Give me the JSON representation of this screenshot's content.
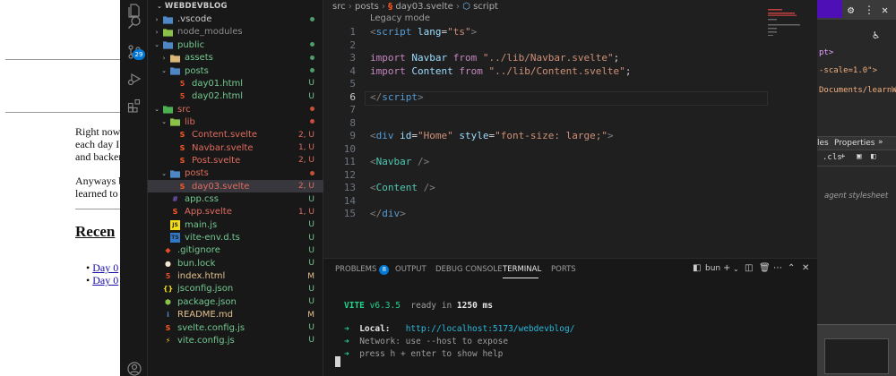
{
  "background_page": {
    "paragraph1": [
      "Right now,",
      "each day I",
      "and backen"
    ],
    "paragraph2": [
      "Anyways b",
      "learned to"
    ],
    "recent_heading": "Recen",
    "recent_items": [
      "Day 0",
      "Day 0"
    ]
  },
  "background_devtools": {
    "code_lines": [
      "pt>",
      "-scale=1.0\">",
      "Documents/learnWe"
    ],
    "tabs": [
      "les",
      "Properties",
      "»"
    ],
    "styles_filter": ".cls",
    "user_agent_text": "agent stylesheet"
  },
  "activity_bar": {
    "scm_badge": "29"
  },
  "explorer": {
    "root": "WEBDEVBLOG",
    "items": [
      {
        "name": ".vscode",
        "type": "folder",
        "open": false,
        "depth": 1,
        "badge": "dot",
        "badge_color": "#4f9d69",
        "name_color": "#cccccc",
        "icon_color": "#4f86c6"
      },
      {
        "name": "node_modules",
        "type": "folder",
        "open": false,
        "depth": 1,
        "badge": "",
        "badge_color": "",
        "name_color": "#8c8c8c",
        "icon_color": "#8bc34a"
      },
      {
        "name": "public",
        "type": "folder",
        "open": true,
        "depth": 1,
        "badge": "dot",
        "badge_color": "#4f9d69",
        "name_color": "#73c991",
        "icon_color": "#4f86c6"
      },
      {
        "name": "assets",
        "type": "folder",
        "open": false,
        "depth": 2,
        "badge": "dot",
        "badge_color": "#4f9d69",
        "name_color": "#73c991",
        "icon_color": "#dcb67a"
      },
      {
        "name": "posts",
        "type": "folder",
        "open": true,
        "depth": 2,
        "badge": "dot",
        "badge_color": "#4f9d69",
        "name_color": "#73c991",
        "icon_color": "#4f86c6"
      },
      {
        "name": "day01.html",
        "type": "html",
        "depth": 3,
        "badge": "U",
        "badge_color": "#73c991",
        "name_color": "#73c991",
        "icon_color": "#e44d26"
      },
      {
        "name": "day02.html",
        "type": "html",
        "depth": 3,
        "badge": "U",
        "badge_color": "#73c991",
        "name_color": "#73c991",
        "icon_color": "#e44d26"
      },
      {
        "name": "src",
        "type": "folder",
        "open": true,
        "depth": 1,
        "badge": "dot",
        "badge_color": "#c74e39",
        "name_color": "#e06c5e",
        "icon_color": "#4caf50"
      },
      {
        "name": "lib",
        "type": "folder",
        "open": true,
        "depth": 2,
        "badge": "dot",
        "badge_color": "#c74e39",
        "name_color": "#e06c5e",
        "icon_color": "#8bc34a"
      },
      {
        "name": "Content.svelte",
        "type": "svelte",
        "depth": 3,
        "badge": "2, U",
        "badge_color": "#e06c5e",
        "name_color": "#e06c5e",
        "icon_color": "#ff5722"
      },
      {
        "name": "Navbar.svelte",
        "type": "svelte",
        "depth": 3,
        "badge": "1, U",
        "badge_color": "#e06c5e",
        "name_color": "#e06c5e",
        "icon_color": "#ff5722"
      },
      {
        "name": "Post.svelte",
        "type": "svelte",
        "depth": 3,
        "badge": "2, U",
        "badge_color": "#e06c5e",
        "name_color": "#e06c5e",
        "icon_color": "#ff5722"
      },
      {
        "name": "posts",
        "type": "folder",
        "open": true,
        "depth": 2,
        "badge": "dot",
        "badge_color": "#c74e39",
        "name_color": "#e06c5e",
        "icon_color": "#4f86c6"
      },
      {
        "name": "day03.svelte",
        "type": "svelte",
        "depth": 3,
        "badge": "2, U",
        "badge_color": "#e06c5e",
        "name_color": "#e06c5e",
        "icon_color": "#ff5722",
        "selected": true
      },
      {
        "name": "app.css",
        "type": "css",
        "depth": 2,
        "badge": "U",
        "badge_color": "#73c991",
        "name_color": "#73c991",
        "icon_color": "#7e57c2"
      },
      {
        "name": "App.svelte",
        "type": "svelte",
        "depth": 2,
        "badge": "1, U",
        "badge_color": "#e06c5e",
        "name_color": "#e06c5e",
        "icon_color": "#ff5722"
      },
      {
        "name": "main.js",
        "type": "js",
        "depth": 2,
        "badge": "U",
        "badge_color": "#73c991",
        "name_color": "#73c991",
        "icon_color": "#f5de19"
      },
      {
        "name": "vite-env.d.ts",
        "type": "ts",
        "depth": 2,
        "badge": "U",
        "badge_color": "#73c991",
        "name_color": "#73c991",
        "icon_color": "#3178c6"
      },
      {
        "name": ".gitignore",
        "type": "git",
        "depth": 1,
        "badge": "U",
        "badge_color": "#73c991",
        "name_color": "#73c991",
        "icon_color": "#e44d26"
      },
      {
        "name": "bun.lock",
        "type": "bun",
        "depth": 1,
        "badge": "U",
        "badge_color": "#73c991",
        "name_color": "#73c991",
        "icon_color": "#f5e6d3"
      },
      {
        "name": "index.html",
        "type": "html",
        "depth": 1,
        "badge": "M",
        "badge_color": "#e2c08d",
        "name_color": "#e2c08d",
        "icon_color": "#e44d26"
      },
      {
        "name": "jsconfig.json",
        "type": "json",
        "depth": 1,
        "badge": "U",
        "badge_color": "#73c991",
        "name_color": "#73c991",
        "icon_color": "#f5de19"
      },
      {
        "name": "package.json",
        "type": "npm",
        "depth": 1,
        "badge": "U",
        "badge_color": "#73c991",
        "name_color": "#73c991",
        "icon_color": "#8bc34a"
      },
      {
        "name": "README.md",
        "type": "info",
        "depth": 1,
        "badge": "M",
        "badge_color": "#e2c08d",
        "name_color": "#e2c08d",
        "icon_color": "#4f86c6"
      },
      {
        "name": "svelte.config.js",
        "type": "svelte",
        "depth": 1,
        "badge": "U",
        "badge_color": "#73c991",
        "name_color": "#73c991",
        "icon_color": "#ff5722"
      },
      {
        "name": "vite.config.js",
        "type": "vite",
        "depth": 1,
        "badge": "U",
        "badge_color": "#73c991",
        "name_color": "#73c991",
        "icon_color": "#ffca28"
      }
    ]
  },
  "breadcrumb": [
    "src",
    "posts",
    "day03.svelte",
    "script"
  ],
  "editor": {
    "codelens": "Legacy mode",
    "current_line": 6,
    "lines": [
      [
        [
          "<",
          "p"
        ],
        [
          "script",
          "t sq"
        ],
        [
          " ",
          "n"
        ],
        [
          "lang",
          "a"
        ],
        [
          "=",
          "n"
        ],
        [
          "\"ts\"",
          "s"
        ],
        [
          ">",
          "p"
        ]
      ],
      [],
      [
        [
          "import",
          "k"
        ],
        [
          " ",
          "n"
        ],
        [
          "Navbar",
          "a"
        ],
        [
          " ",
          "n"
        ],
        [
          "from",
          "k"
        ],
        [
          " ",
          "n"
        ],
        [
          "\"../lib/Navbar.svelte\"",
          "s sq"
        ],
        [
          ";",
          "n"
        ]
      ],
      [
        [
          "import",
          "k"
        ],
        [
          " ",
          "n"
        ],
        [
          "Content",
          "a"
        ],
        [
          " ",
          "n"
        ],
        [
          "from",
          "k"
        ],
        [
          " ",
          "n"
        ],
        [
          "\"../lib/Content.svelte\"",
          "s sq"
        ],
        [
          ";",
          "n"
        ]
      ],
      [],
      [
        [
          "</",
          "p"
        ],
        [
          "script",
          "t"
        ],
        [
          ">",
          "p"
        ]
      ],
      [],
      [],
      [
        [
          "<",
          "p"
        ],
        [
          "div",
          "t"
        ],
        [
          " ",
          "n"
        ],
        [
          "id",
          "a"
        ],
        [
          "=",
          "n"
        ],
        [
          "\"Home\"",
          "s"
        ],
        [
          " ",
          "n"
        ],
        [
          "style",
          "a"
        ],
        [
          "=",
          "n"
        ],
        [
          "\"font-size: large;\"",
          "s"
        ],
        [
          ">",
          "p"
        ]
      ],
      [],
      [
        [
          "<",
          "p"
        ],
        [
          "Navbar",
          "c"
        ],
        [
          " />",
          "p"
        ]
      ],
      [],
      [
        [
          "<",
          "p"
        ],
        [
          "Content",
          "c"
        ],
        [
          " />",
          "p"
        ]
      ],
      [],
      [
        [
          "</",
          "p"
        ],
        [
          "div",
          "t"
        ],
        [
          ">",
          "p"
        ]
      ]
    ]
  },
  "panel": {
    "tabs": [
      {
        "label": "PROBLEMS",
        "badge": "8"
      },
      {
        "label": "OUTPUT",
        "badge": ""
      },
      {
        "label": "DEBUG CONSOLE",
        "badge": ""
      },
      {
        "label": "TERMINAL",
        "badge": ""
      },
      {
        "label": "PORTS",
        "badge": ""
      }
    ],
    "active_tab": "TERMINAL",
    "terminal_name": "bun",
    "terminal": {
      "vite_name": "VITE",
      "vite_version": "v6.3.5",
      "ready_text": "ready in",
      "ready_ms": "1250 ms",
      "arrow": "➜",
      "local_label": "Local:",
      "local_url": "http://localhost:5173/webdevblog/",
      "network_line": "Network: use --host to expose",
      "help_line": "press h + enter to show help"
    }
  },
  "colors": {
    "accent": "#0078d4",
    "terminal_green": "#23d18b",
    "terminal_cyan": "#29b8db"
  }
}
